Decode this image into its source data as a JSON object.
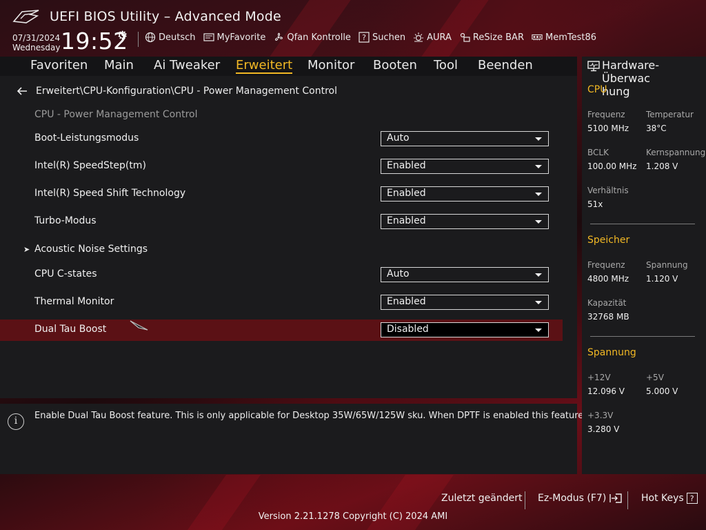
{
  "app": {
    "title": "UEFI BIOS Utility – Advanced Mode",
    "date": "07/31/2024",
    "weekday": "Wednesday",
    "time": "19:52"
  },
  "toolbar": {
    "items": [
      {
        "label": "Deutsch",
        "icon": "globe-icon"
      },
      {
        "label": "MyFavorite",
        "icon": "favorite-icon"
      },
      {
        "label": "Qfan Kontrolle",
        "icon": "fan-icon"
      },
      {
        "label": "Suchen",
        "icon": "help-search-icon"
      },
      {
        "label": "AURA",
        "icon": "aura-icon"
      },
      {
        "label": "ReSize BAR",
        "icon": "resize-bar-icon"
      },
      {
        "label": "MemTest86",
        "icon": "memtest-icon"
      }
    ]
  },
  "tabs": [
    "Favoriten",
    "Main",
    "Ai Tweaker",
    "Erweitert",
    "Monitor",
    "Booten",
    "Tool",
    "Beenden"
  ],
  "active_tab": "Erweitert",
  "breadcrumb": "Erweitert\\CPU-Konfiguration\\CPU - Power Management Control",
  "section_title": "CPU - Power Management Control",
  "settings": [
    {
      "label": "Boot-Leistungsmodus",
      "value": "Auto"
    },
    {
      "label": "Intel(R) SpeedStep(tm)",
      "value": "Enabled"
    },
    {
      "label": "Intel(R) Speed Shift Technology",
      "value": "Enabled"
    },
    {
      "label": "Turbo-Modus",
      "value": "Enabled"
    },
    {
      "label": "Acoustic Noise Settings",
      "value": null,
      "submenu": true
    },
    {
      "label": "CPU C-states",
      "value": "Auto"
    },
    {
      "label": "Thermal Monitor",
      "value": "Enabled"
    },
    {
      "label": "Dual Tau Boost",
      "value": "Disabled",
      "selected": true
    }
  ],
  "help_text": "Enable Dual Tau Boost feature. This is only applicable for Desktop 35W/65W/125W sku. When DPTF is enabled this feature is ignored.",
  "monitor": {
    "title": "Hardware-Überwachung",
    "title_line1": "Hardware-Überwac",
    "title_line2": "hung",
    "cpu": {
      "heading": "CPU",
      "freq_label": "Frequenz",
      "freq": "5100 MHz",
      "temp_label": "Temperatur",
      "temp": "38°C",
      "bclk_label": "BCLK",
      "bclk": "100.00 MHz",
      "core_v_label": "Kernspannung",
      "core_v": "1.208 V",
      "ratio_label": "Verhältnis",
      "ratio": "51x"
    },
    "memory": {
      "heading": "Speicher",
      "freq_label": "Frequenz",
      "freq": "4800 MHz",
      "volt_label": "Spannung",
      "volt": "1.120 V",
      "cap_label": "Kapazität",
      "cap": "32768 MB"
    },
    "voltage": {
      "heading": "Spannung",
      "v12_label": "+12V",
      "v12": "12.096 V",
      "v5_label": "+5V",
      "v5": "5.000 V",
      "v33_label": "+3.3V",
      "v33": "3.280 V"
    }
  },
  "footer": {
    "last_changed": "Zuletzt geändert",
    "ez_mode": "Ez-Modus (F7)",
    "hot_keys": "Hot Keys",
    "hot_keys_key": "?",
    "version": "Version 2.21.1278 Copyright (C) 2024 AMI"
  },
  "colors": {
    "accent": "#f2b824",
    "selected_row": "#5b1115",
    "panel": "#1b1b1d"
  }
}
